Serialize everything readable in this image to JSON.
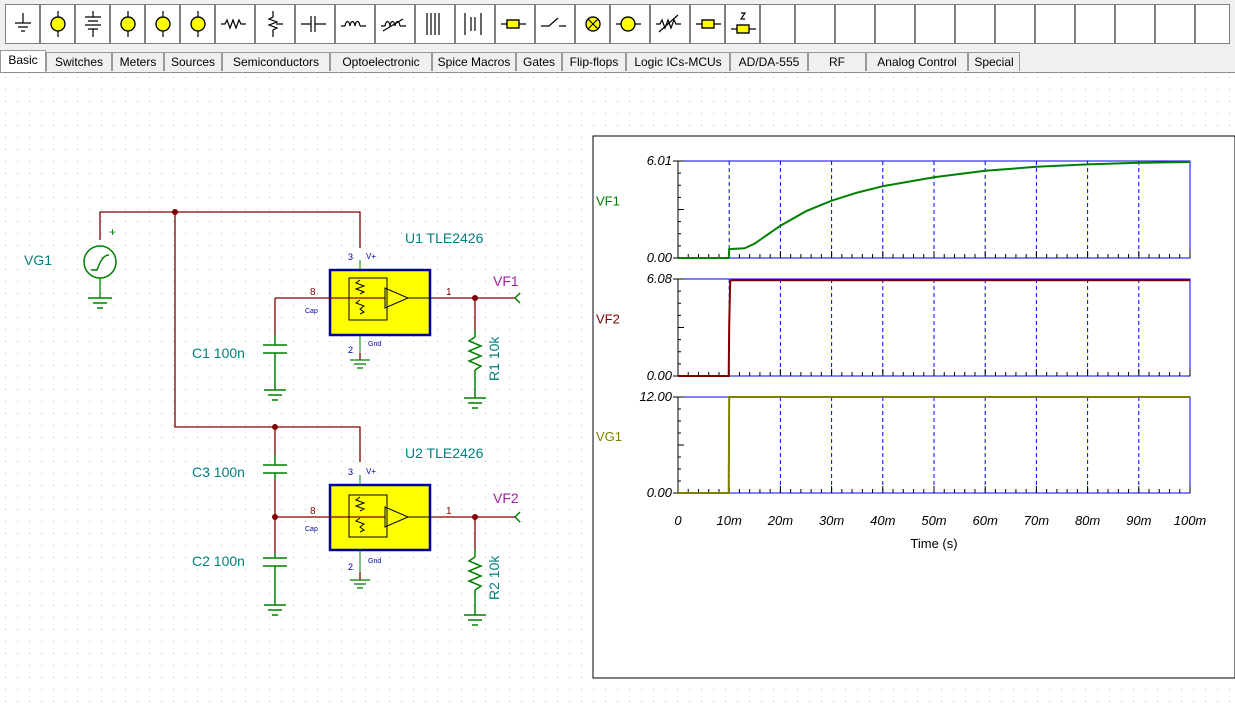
{
  "tabs": [
    "Basic",
    "Switches",
    "Meters",
    "Sources",
    "Semiconductors",
    "Optoelectronic",
    "Spice Macros",
    "Gates",
    "Flip-flops",
    "Logic ICs-MCUs",
    "AD/DA-555",
    "RF",
    "Analog Control",
    "Special"
  ],
  "toolbar_icons": [
    "ground-icon",
    "voltage-source-icon",
    "battery-icon",
    "voltmeter-icon",
    "voltmeter-probe-icon",
    "ammeter-icon",
    "resistor-icon",
    "potentiometer-icon",
    "capacitor-icon",
    "inductor-icon",
    "variable-inductor-icon",
    "transformer-icon",
    "coupled-inductor-icon",
    "fuse-icon",
    "switch-icon",
    "lamp-icon",
    "motor-icon",
    "variable-resistor-icon",
    "crystal-icon",
    "zener-icon"
  ],
  "schematic": {
    "vg1": "VG1",
    "u1": "U1 TLE2426",
    "u2": "U2 TLE2426",
    "c1": "C1 100n",
    "c2": "C2 100n",
    "c3": "C3 100n",
    "r1": "R1 10k",
    "r2": "R2 10k",
    "vf1": "VF1",
    "vf2": "VF2",
    "pin3": "3",
    "pin8": "8",
    "pin1": "1",
    "pin2": "2",
    "vplus": "V+",
    "cap": "Cap",
    "gnd": "Gnd",
    "plus": "+"
  },
  "colors": {
    "wire": "#800000",
    "component": "#008000",
    "label": "#008080",
    "probe": "#a020a0",
    "ic_fill": "#ffff00",
    "ic_border": "#0000a0",
    "axis_blue": "#0000ff"
  },
  "chart_data": {
    "type": "line",
    "xlabel": "Time (s)",
    "x_ticks": [
      "0",
      "10m",
      "20m",
      "30m",
      "40m",
      "50m",
      "60m",
      "70m",
      "80m",
      "90m",
      "100m"
    ],
    "xlim": [
      0,
      0.1
    ],
    "grid": "vertical dashed",
    "panels": [
      {
        "name": "VF1",
        "ymin_label": "0.00",
        "ymax_label": "6.01",
        "ylim": [
          0,
          6.01
        ],
        "color": "#008000",
        "x": [
          0,
          0.0099,
          0.01,
          0.013,
          0.015,
          0.02,
          0.025,
          0.03,
          0.035,
          0.04,
          0.05,
          0.06,
          0.07,
          0.08,
          0.09,
          0.1
        ],
        "y": [
          0,
          0,
          0.55,
          0.6,
          0.9,
          2.0,
          2.9,
          3.55,
          4.05,
          4.45,
          5.0,
          5.4,
          5.65,
          5.8,
          5.9,
          5.95
        ]
      },
      {
        "name": "VF2",
        "ymin_label": "0.00",
        "ymax_label": "6.08",
        "ylim": [
          0,
          6.08
        ],
        "color": "#800000",
        "x": [
          0,
          0.0099,
          0.01,
          0.0102,
          0.0105,
          0.1
        ],
        "y": [
          0,
          0,
          3.2,
          5.95,
          6.0,
          6.0
        ]
      },
      {
        "name": "VG1",
        "ymin_label": "0.00",
        "ymax_label": "12.00",
        "ylim": [
          0,
          12
        ],
        "color": "#808000",
        "x": [
          0,
          0.0099,
          0.01,
          0.1
        ],
        "y": [
          0,
          0,
          12,
          12
        ]
      }
    ]
  }
}
